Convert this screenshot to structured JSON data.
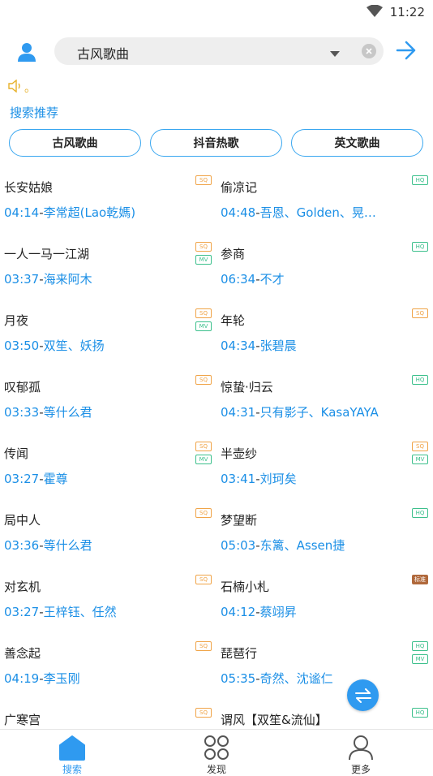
{
  "status_bar": {
    "time": "11:22"
  },
  "search": {
    "value": "古风歌曲"
  },
  "notice": {
    "text": "。"
  },
  "recommend": {
    "label": "搜索推荐",
    "chips": [
      "古风歌曲",
      "抖音热歌",
      "英文歌曲"
    ]
  },
  "songs": [
    {
      "title": "长安姑娘",
      "duration": "04:14",
      "separator": "-",
      "artist": "李常超(Lao乾媽)",
      "tags": [
        "SQ"
      ]
    },
    {
      "title": "偷凉记",
      "duration": "04:48",
      "separator": "-",
      "artist": "吾恩、Golden、晃儿…",
      "tags": [
        "HQ"
      ]
    },
    {
      "title": "一人一马一江湖",
      "duration": "03:37",
      "separator": "-",
      "artist": "海来阿木",
      "tags": [
        "SQ",
        "MV"
      ]
    },
    {
      "title": "参商",
      "duration": "06:34",
      "separator": "-",
      "artist": "不才",
      "tags": [
        "HQ"
      ]
    },
    {
      "title": "月夜",
      "duration": "03:50",
      "separator": "-",
      "artist": "双笙、妖扬",
      "tags": [
        "SQ",
        "MV"
      ]
    },
    {
      "title": "年轮",
      "duration": "04:34",
      "separator": "-",
      "artist": "张碧晨",
      "tags": [
        "SQ"
      ]
    },
    {
      "title": "叹郁孤",
      "duration": "03:33",
      "separator": "-",
      "artist": "等什么君",
      "tags": [
        "SQ"
      ]
    },
    {
      "title": "惊蛰·归云",
      "duration": "04:31",
      "separator": "-",
      "artist": "只有影子、KasaYAYA",
      "tags": [
        "HQ"
      ]
    },
    {
      "title": "传闻",
      "duration": "03:27",
      "separator": "-",
      "artist": "霍尊",
      "tags": [
        "SQ",
        "MV"
      ]
    },
    {
      "title": "半壶纱",
      "duration": "03:41",
      "separator": "-",
      "artist": "刘珂矣",
      "tags": [
        "SQ",
        "MV"
      ]
    },
    {
      "title": "局中人",
      "duration": "03:36",
      "separator": "-",
      "artist": "等什么君",
      "tags": [
        "SQ"
      ]
    },
    {
      "title": "梦望断",
      "duration": "05:03",
      "separator": "-",
      "artist": "东篱、Assen捷",
      "tags": [
        "HQ"
      ]
    },
    {
      "title": "对玄机",
      "duration": "03:27",
      "separator": "-",
      "artist": "王梓钰、任然",
      "tags": [
        "SQ"
      ]
    },
    {
      "title": "石楠小札",
      "duration": "04:12",
      "separator": "-",
      "artist": "蔡翊昇",
      "tags": [
        "标准"
      ]
    },
    {
      "title": "善念起",
      "duration": "04:19",
      "separator": "-",
      "artist": "李玉刚",
      "tags": [
        "SQ"
      ]
    },
    {
      "title": "琵琶行",
      "duration": "05:35",
      "separator": "-",
      "artist": "奇然、沈谧仁",
      "tags": [
        "HQ",
        "MV"
      ]
    },
    {
      "title": "广寒宫",
      "duration": "",
      "separator": "",
      "artist": "",
      "tags": [
        "SQ"
      ]
    },
    {
      "title": "谓风【双笙&流仙】",
      "duration": "",
      "separator": "",
      "artist": "",
      "tags": [
        "HQ"
      ]
    }
  ],
  "bottom_nav": [
    {
      "label": "搜索",
      "icon": "home-icon",
      "active": true
    },
    {
      "label": "发现",
      "icon": "grid-icon",
      "active": false
    },
    {
      "label": "更多",
      "icon": "person-icon",
      "active": false
    }
  ],
  "colors": {
    "accent": "#1b8fe6",
    "sq": "#f0a448",
    "hq": "#3cc08c",
    "fab": "#2f9af0"
  }
}
